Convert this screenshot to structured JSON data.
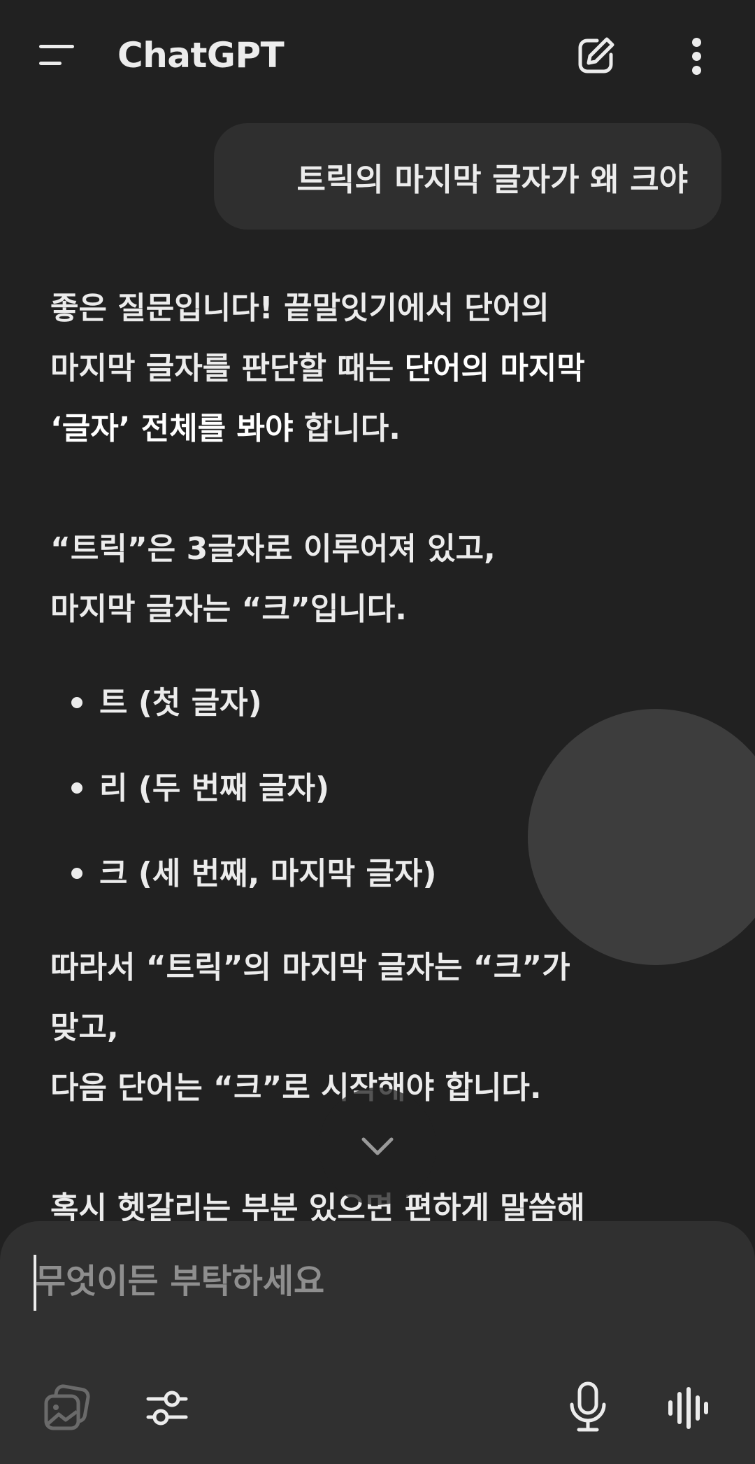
{
  "header": {
    "title": "ChatGPT",
    "menu_icon": "hamburger-menu-icon",
    "new_chat_icon": "edit-icon",
    "more_icon": "more-vertical-icon"
  },
  "conversation": {
    "user_message": "트릭의 마지막 글자가 왜 크야",
    "assistant": {
      "p1_line1": "좋은 질문입니다! 끝말잇기에서 단어의",
      "p1_line2_plain": "마지막 글자를 판단할 때는 ",
      "p1_line2_bold": "단어의 마지막",
      "p1_line3_bold": "‘글자’ 전체를 봐야",
      "p1_line3_plain": " 합니다.",
      "p2_line1": "“트릭”은 3글자로 이루어져 있고,",
      "p2_line2": "마지막 글자는 “크”입니다.",
      "bullets": [
        "트 (첫 글자)",
        "리 (두 번째 글자)",
        "크 (세 번째, 마지막 글자)"
      ],
      "p3_line1": "따라서 “트릭”의 마지막 글자는 “크”가",
      "p3_line2": "맞고,",
      "p3_line3": "다음 단어는 “크”로 시작해야 합니다.",
      "p4_line1": "혹시 헷갈리는 부분 있으면 편하게 말씀해"
    }
  },
  "composer": {
    "placeholder": "무엇이든 부탁하세요",
    "attach_icon": "image-gallery-icon",
    "tools_icon": "sliders-icon",
    "mic_icon": "microphone-icon",
    "voice_icon": "voice-waveform-icon"
  },
  "colors": {
    "background": "#212121",
    "bubble": "#2f2f2f",
    "composer": "#303030",
    "text": "#ececec",
    "placeholder": "#8e8e8e"
  }
}
